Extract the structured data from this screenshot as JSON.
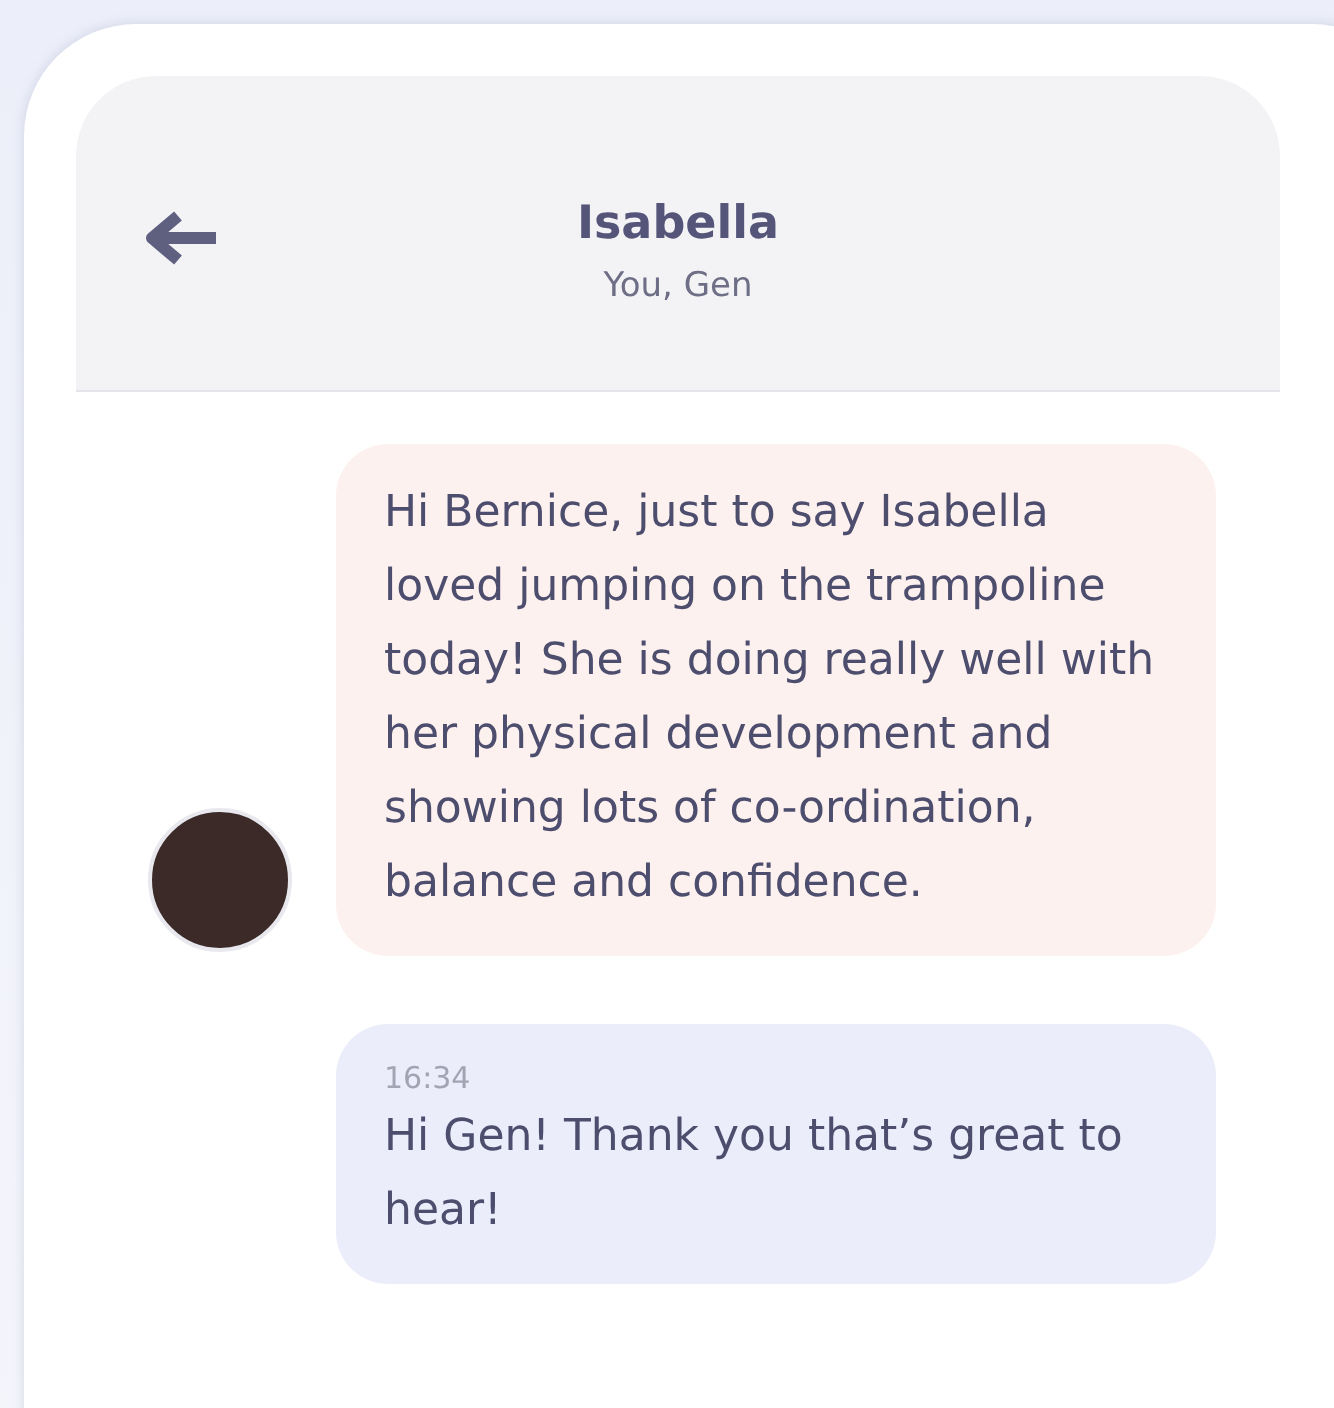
{
  "header": {
    "title": "Isabella",
    "subtitle": "You, Gen"
  },
  "messages": [
    {
      "kind": "received",
      "text": "Hi Bernice, just to say Isabella loved jumping on the trampoline today! She is doing really well with her physical development and showing lots of co-ordination, balance and confidence."
    },
    {
      "kind": "sent",
      "time": "16:34",
      "text": "Hi Gen! Thank you that’s great to hear!"
    }
  ]
}
